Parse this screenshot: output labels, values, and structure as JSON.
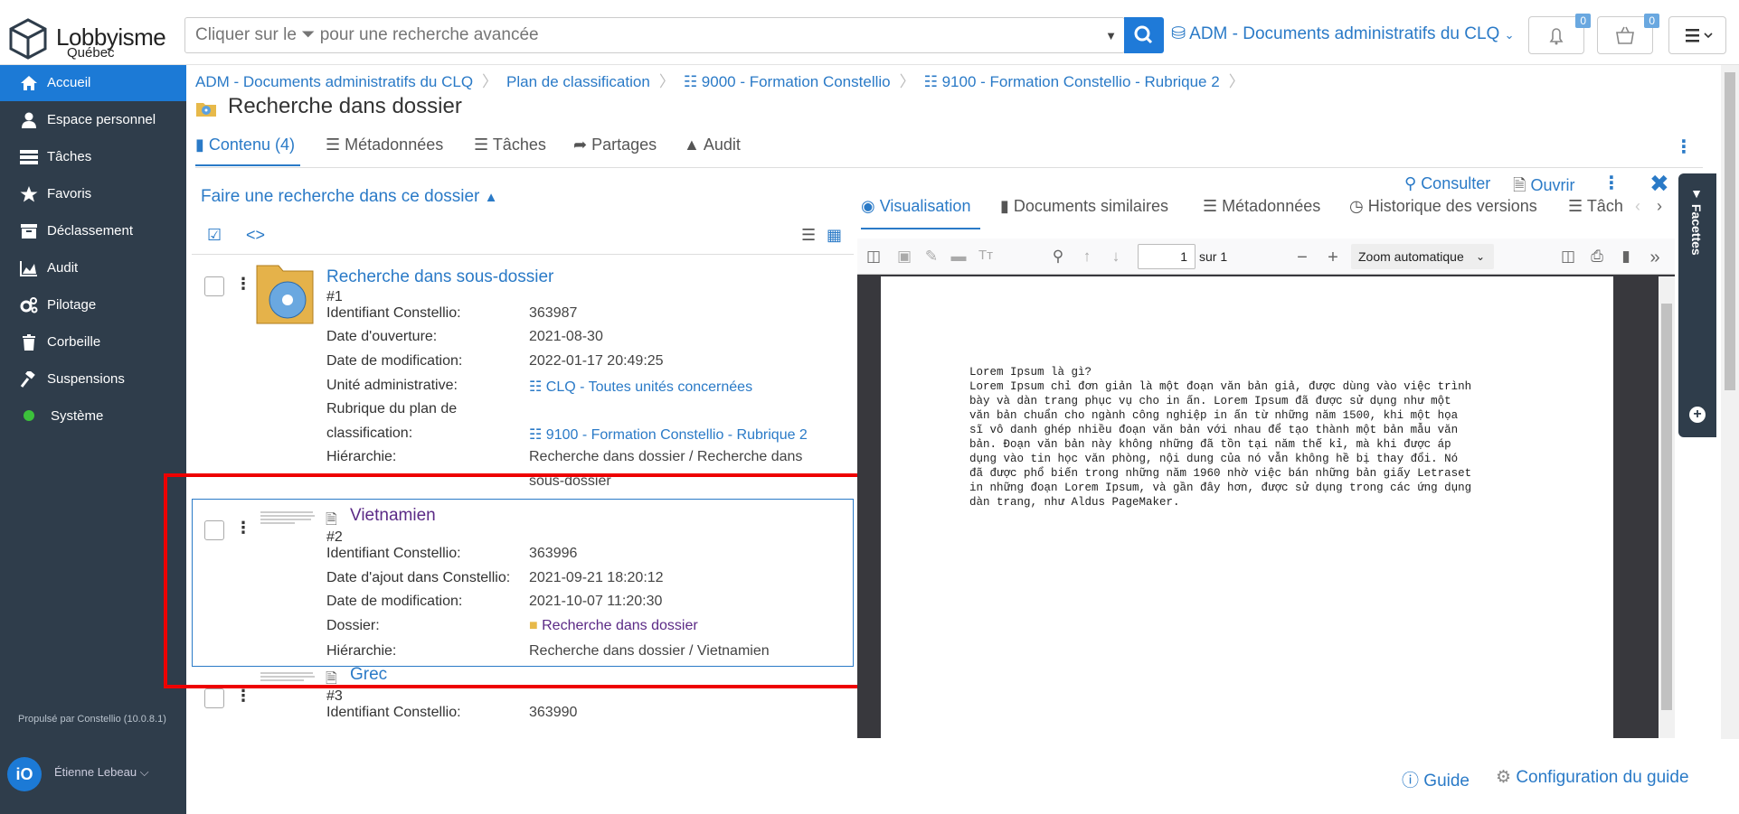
{
  "header": {
    "logo_text": "Lobbyisme",
    "logo_sub": "Québec",
    "search_placeholder": "Cliquer sur le ⏷ pour une recherche avancée",
    "collection": "ADM - Documents administratifs du CLQ",
    "notifications_count": "0",
    "cart_count": "0"
  },
  "sidebar": {
    "items": [
      {
        "label": "Accueil",
        "icon": "home-icon"
      },
      {
        "label": "Espace personnel",
        "icon": "user-icon"
      },
      {
        "label": "Tâches",
        "icon": "tasks-icon"
      },
      {
        "label": "Favoris",
        "icon": "star-icon"
      },
      {
        "label": "Déclassement",
        "icon": "archive-icon"
      },
      {
        "label": "Audit",
        "icon": "chart-icon"
      },
      {
        "label": "Pilotage",
        "icon": "gears-icon"
      },
      {
        "label": "Corbeille",
        "icon": "trash-icon"
      },
      {
        "label": "Suspensions",
        "icon": "gavel-icon"
      },
      {
        "label": "Système",
        "icon": "status-dot-icon"
      }
    ],
    "powered_by": "Propulsé par Constellio (10.0.8.1)",
    "user_initials": "iO",
    "user_name": "Étienne Lebeau ⌵"
  },
  "breadcrumb": [
    "ADM - Documents administratifs du CLQ",
    "Plan de classification",
    "9000 - Formation Constellio",
    "9100 - Formation Constellio - Rubrique 2"
  ],
  "page_title": "Recherche dans dossier",
  "tabs": [
    "Contenu (4)",
    "Métadonnées",
    "Tâches",
    "Partages",
    "Audit"
  ],
  "search_toggle": "Faire une recherche dans ce dossier",
  "records": [
    {
      "title": "Recherche dans sous-dossier",
      "num": "#1",
      "meta": [
        {
          "k": "Identifiant Constellio:",
          "v": "363987"
        },
        {
          "k": "Date d'ouverture:",
          "v": "2021-08-30"
        },
        {
          "k": "Date de modification:",
          "v": "2022-01-17 20:49:25"
        },
        {
          "k": "Unité administrative:",
          "v": "CLQ - Toutes unités concernées"
        },
        {
          "k": "Rubrique du plan de",
          "v": ""
        },
        {
          "k": "classification:",
          "v": "9100 - Formation Constellio - Rubrique 2"
        },
        {
          "k": "Hiérarchie:",
          "v": "Recherche dans dossier / Recherche dans"
        },
        {
          "k": "",
          "v": "sous-dossier"
        }
      ]
    },
    {
      "title": "Vietnamien",
      "num": "#2",
      "meta": [
        {
          "k": "Identifiant Constellio:",
          "v": "363996"
        },
        {
          "k": "Date d'ajout dans Constellio:",
          "v": "2021-09-21 18:20:12"
        },
        {
          "k": "Date de modification:",
          "v": "2021-10-07 11:20:30"
        },
        {
          "k": "Dossier:",
          "v": "Recherche dans dossier"
        },
        {
          "k": "Hiérarchie:",
          "v": "Recherche dans dossier / Vietnamien"
        }
      ]
    },
    {
      "title": "Grec",
      "num": "#3",
      "meta": [
        {
          "k": "Identifiant Constellio:",
          "v": "363990"
        }
      ]
    }
  ],
  "preview": {
    "actions": {
      "consult": "Consulter",
      "open": "Ouvrir"
    },
    "tabs": [
      "Visualisation",
      "Documents similaires",
      "Métadonnées",
      "Historique des versions",
      "Tâche"
    ],
    "pdf": {
      "page": "1",
      "of": "sur 1",
      "zoom": "Zoom automatique",
      "text": "Lorem Ipsum là gì?\nLorem Ipsum chỉ đơn giản là một đoạn văn bản giả, được dùng vào việc trình\nbày và dàn trang phục vụ cho in ấn. Lorem Ipsum đã được sử dụng như một\nvăn bản chuẩn cho ngành công nghiệp in ấn từ những năm 1500, khi một họa\nsĩ vô danh ghép nhiều đoạn văn bản với nhau để tạo thành một bản mẫu văn\nbản. Đoạn văn bản này không những đã tồn tại năm thế kỉ, mà khi được áp\ndụng vào tin học văn phòng, nội dung của nó vẫn không hề bị thay đổi. Nó\nđã được phổ biến trong những năm 1960 nhờ việc bán những bản giấy Letraset\nin những đoạn Lorem Ipsum, và gần đây hơn, được sử dụng trong các ứng dụng\ndàn trang, như Aldus PageMaker."
    }
  },
  "facets_label": "Facettes",
  "footer": {
    "guide": "Guide",
    "guide_config": "Configuration du guide"
  }
}
